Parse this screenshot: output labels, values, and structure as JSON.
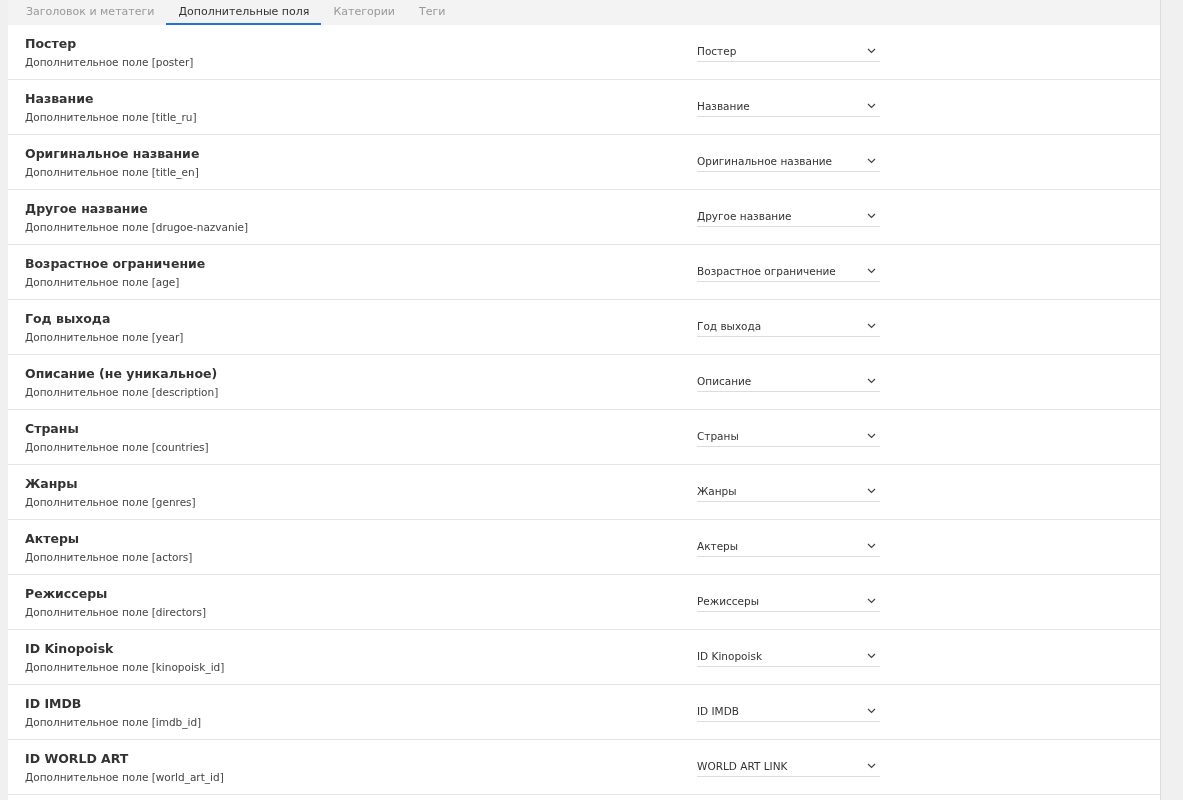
{
  "tabs": [
    {
      "label": "Заголовок и метатеги",
      "selected": false
    },
    {
      "label": "Дополнительные поля",
      "selected": true
    },
    {
      "label": "Категории",
      "selected": false
    },
    {
      "label": "Теги",
      "selected": false
    }
  ],
  "fields": [
    {
      "title": "Постер",
      "description": "Дополнительное поле [poster]",
      "value": "Постер"
    },
    {
      "title": "Название",
      "description": "Дополнительное поле [title_ru]",
      "value": "Название"
    },
    {
      "title": "Оригинальное название",
      "description": "Дополнительное поле [title_en]",
      "value": "Оригинальное название"
    },
    {
      "title": "Другое название",
      "description": "Дополнительное поле [drugoe-nazvanie]",
      "value": "Другое название"
    },
    {
      "title": "Возрастное ограничение",
      "description": "Дополнительное поле [age]",
      "value": "Возрастное ограничение"
    },
    {
      "title": "Год выхода",
      "description": "Дополнительное поле [year]",
      "value": "Год выхода"
    },
    {
      "title": "Описание (не уникальное)",
      "description": "Дополнительное поле [description]",
      "value": "Описание"
    },
    {
      "title": "Страны",
      "description": "Дополнительное поле [countries]",
      "value": "Страны"
    },
    {
      "title": "Жанры",
      "description": "Дополнительное поле [genres]",
      "value": "Жанры"
    },
    {
      "title": "Актеры",
      "description": "Дополнительное поле [actors]",
      "value": "Актеры"
    },
    {
      "title": "Режиссеры",
      "description": "Дополнительное поле [directors]",
      "value": "Режиссеры"
    },
    {
      "title": "ID Kinopoisk",
      "description": "Дополнительное поле [kinopoisk_id]",
      "value": "ID Kinopoisk"
    },
    {
      "title": "ID IMDB",
      "description": "Дополнительное поле [imdb_id]",
      "value": "ID IMDB"
    },
    {
      "title": "ID WORLD ART",
      "description": "Дополнительное поле [world_art_id]",
      "value": "WORLD ART LINK"
    }
  ]
}
